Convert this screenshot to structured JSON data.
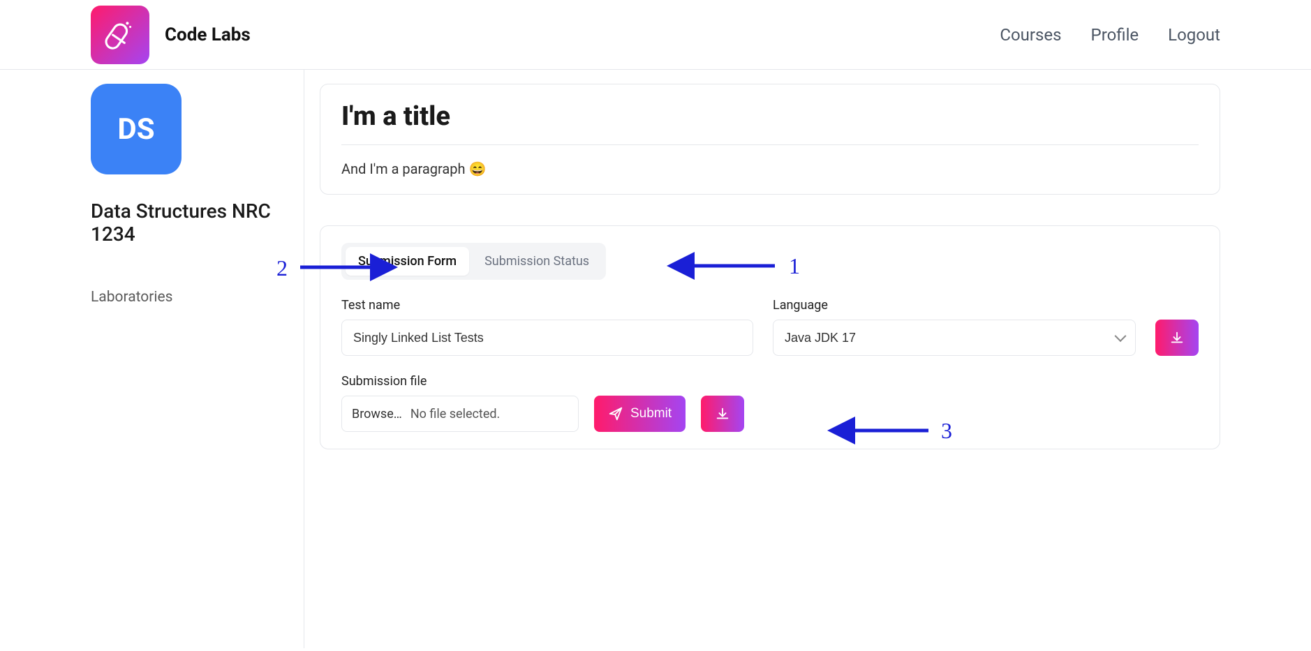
{
  "header": {
    "brand": "Code Labs",
    "nav": {
      "courses": "Courses",
      "profile": "Profile",
      "logout": "Logout"
    }
  },
  "sidebar": {
    "course_initials": "DS",
    "course_name": "Data Structures NRC 1234",
    "items": [
      {
        "label": "Laboratories"
      }
    ]
  },
  "content_card": {
    "title": "I'm a title",
    "paragraph": "And I'm a paragraph 😄"
  },
  "submission": {
    "tabs": [
      {
        "label": "Submission Form",
        "active": true
      },
      {
        "label": "Submission Status",
        "active": false
      }
    ],
    "test_name_label": "Test name",
    "test_name_value": "Singly Linked List Tests",
    "language_label": "Language",
    "language_value": "Java JDK 17",
    "submission_file_label": "Submission file",
    "browse_label": "Browse…",
    "file_status": "No file selected.",
    "submit_label": "Submit"
  },
  "annotations": {
    "a1": "1",
    "a2": "2",
    "a3": "3"
  }
}
